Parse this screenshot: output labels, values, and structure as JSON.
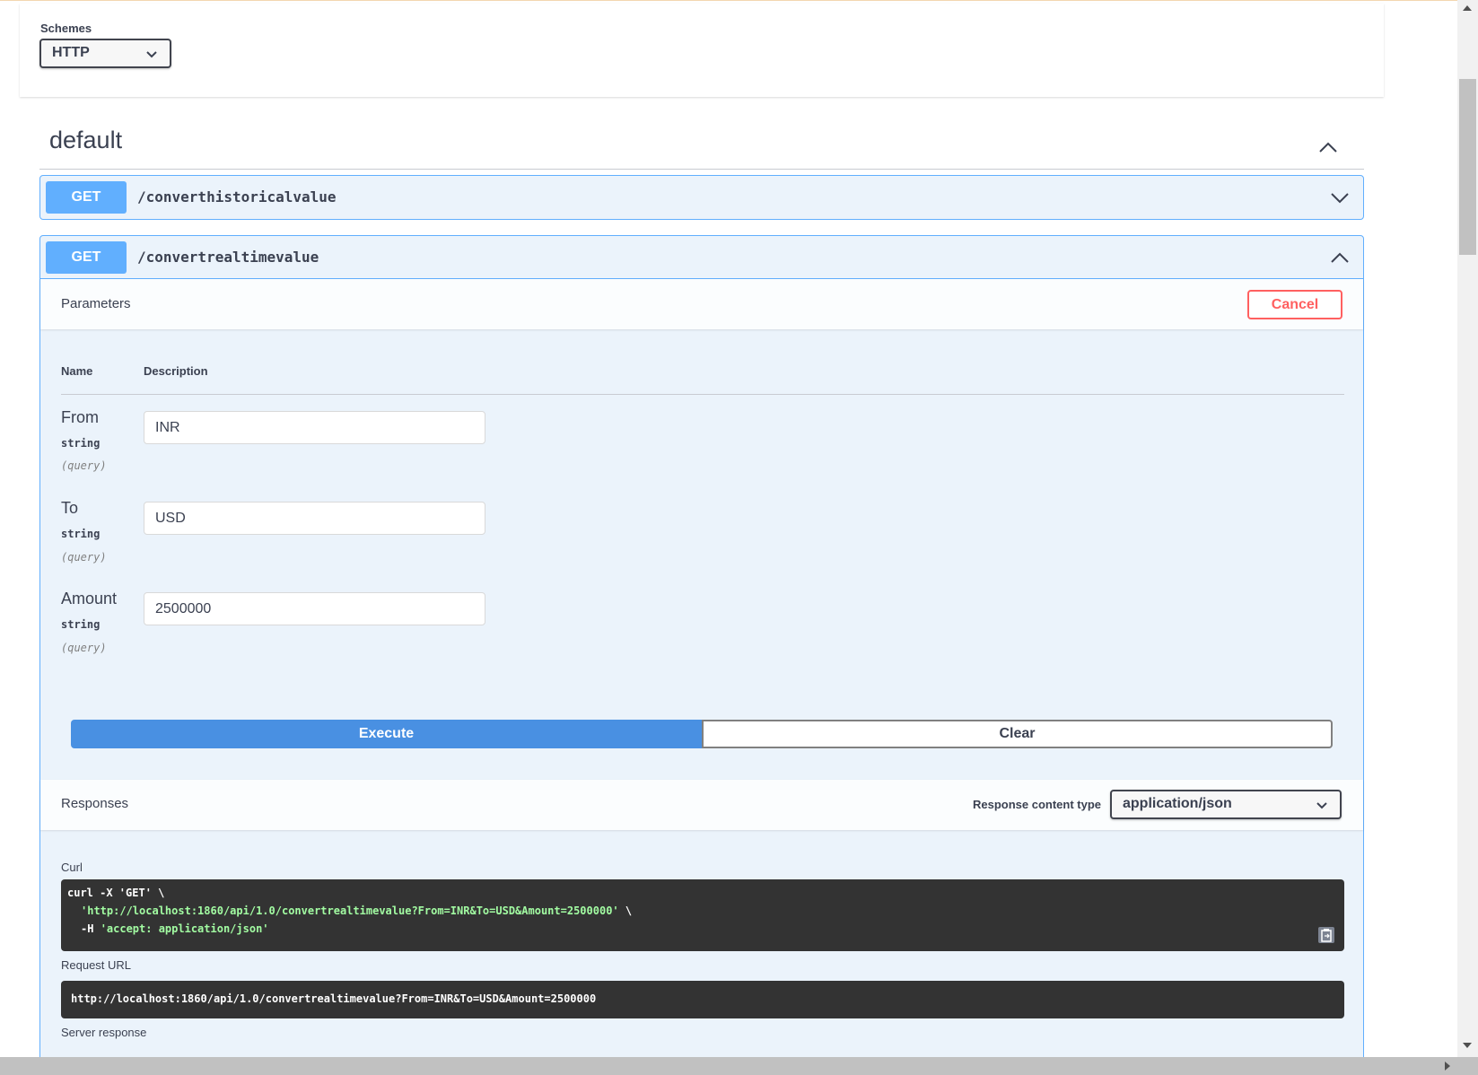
{
  "schemes": {
    "label": "Schemes",
    "selected": "HTTP"
  },
  "section": {
    "title": "default"
  },
  "operations": [
    {
      "method": "GET",
      "path": "/converthistoricalvalue",
      "expanded": false
    },
    {
      "method": "GET",
      "path": "/convertrealtimevalue",
      "expanded": true
    }
  ],
  "parameters": {
    "title": "Parameters",
    "cancel_label": "Cancel",
    "col_name": "Name",
    "col_description": "Description",
    "items": [
      {
        "name": "From",
        "type": "string",
        "in": "(query)",
        "value": "INR"
      },
      {
        "name": "To",
        "type": "string",
        "in": "(query)",
        "value": "USD"
      },
      {
        "name": "Amount",
        "type": "string",
        "in": "(query)",
        "value": "2500000"
      }
    ]
  },
  "actions": {
    "execute_label": "Execute",
    "clear_label": "Clear"
  },
  "responses": {
    "title": "Responses",
    "content_type_label": "Response content type",
    "content_type_value": "application/json",
    "curl_label": "Curl",
    "curl_line1": "curl -X 'GET' \\",
    "curl_line2_url": "'http://localhost:1860/api/1.0/convertrealtimevalue?From=INR&To=USD&Amount=2500000'",
    "curl_line2_tail": " \\",
    "curl_line3_flag": "-H ",
    "curl_line3_header": "'accept: application/json'",
    "request_url_label": "Request URL",
    "request_url": "http://localhost:1860/api/1.0/convertrealtimevalue?From=INR&To=USD&Amount=2500000",
    "server_response_label": "Server response"
  },
  "colors": {
    "get_method": "#61affe",
    "op_background": "#ebf3fb",
    "execute": "#4990e2",
    "cancel": "#ff6060",
    "code_background": "#333333",
    "code_string": "#a2fca2"
  }
}
